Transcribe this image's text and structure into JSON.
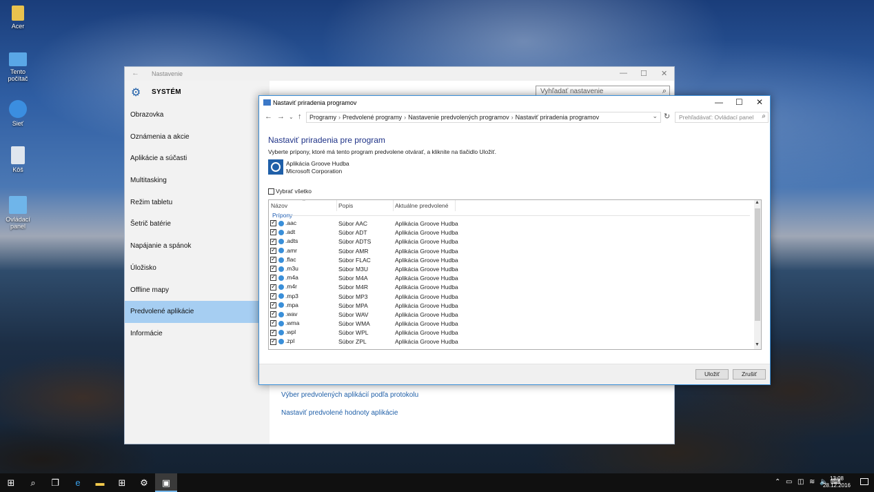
{
  "desktop": {
    "icons": [
      {
        "label": "Acer",
        "icon": "folder-icon"
      },
      {
        "label": "Tento počítač",
        "icon": "computer-icon"
      },
      {
        "label": "Sieť",
        "icon": "network-icon"
      },
      {
        "label": "Kôš",
        "icon": "recycle-bin-icon"
      },
      {
        "label": "Ovládací panel",
        "icon": "control-panel-icon"
      }
    ]
  },
  "settings": {
    "title": "Nastavenie",
    "section": "SYSTÉM",
    "search_placeholder": "Vyhľadať nastavenie",
    "nav": [
      "Obrazovka",
      "Oznámenia a akcie",
      "Aplikácie a súčasti",
      "Multitasking",
      "Režim tabletu",
      "Šetrič batérie",
      "Napájanie a spánok",
      "Úložisko",
      "Offline mapy",
      "Predvolené aplikácie",
      "Informácie"
    ],
    "active_index": 9,
    "links": [
      "Výber predvolených aplikácií podľa protokolu",
      "Nastaviť predvolené hodnoty aplikácie"
    ]
  },
  "dialog": {
    "title": "Nastaviť priradenia programov",
    "breadcrumb": [
      "Programy",
      "Predvolené programy",
      "Nastavenie predvolených programov",
      "Nastaviť priradenia programov"
    ],
    "search_placeholder": "Prehľadávať: Ovládací panel",
    "heading": "Nastaviť priradenia pre program",
    "description": "Vyberte prípony, ktoré má tento program predvolene otvárať, a kliknite na tlačidlo Uložiť.",
    "app_name": "Aplikácia Groove Hudba",
    "app_company": "Microsoft Corporation",
    "select_all": "Vybrať všetko",
    "columns": [
      "Názov",
      "Popis",
      "Aktuálne predvolené"
    ],
    "group": "Prípony",
    "rows": [
      {
        "ext": ".aac",
        "desc": "Súbor AAC",
        "default": "Aplikácia Groove Hudba"
      },
      {
        "ext": ".adt",
        "desc": "Súbor ADT",
        "default": "Aplikácia Groove Hudba"
      },
      {
        "ext": ".adts",
        "desc": "Súbor ADTS",
        "default": "Aplikácia Groove Hudba"
      },
      {
        "ext": ".amr",
        "desc": "Súbor AMR",
        "default": "Aplikácia Groove Hudba"
      },
      {
        "ext": ".flac",
        "desc": "Súbor FLAC",
        "default": "Aplikácia Groove Hudba"
      },
      {
        "ext": ".m3u",
        "desc": "Súbor M3U",
        "default": "Aplikácia Groove Hudba"
      },
      {
        "ext": ".m4a",
        "desc": "Súbor M4A",
        "default": "Aplikácia Groove Hudba"
      },
      {
        "ext": ".m4r",
        "desc": "Súbor M4R",
        "default": "Aplikácia Groove Hudba"
      },
      {
        "ext": ".mp3",
        "desc": "Súbor MP3",
        "default": "Aplikácia Groove Hudba"
      },
      {
        "ext": ".mpa",
        "desc": "Súbor MPA",
        "default": "Aplikácia Groove Hudba"
      },
      {
        "ext": ".wav",
        "desc": "Súbor WAV",
        "default": "Aplikácia Groove Hudba"
      },
      {
        "ext": ".wma",
        "desc": "Súbor WMA",
        "default": "Aplikácia Groove Hudba"
      },
      {
        "ext": ".wpl",
        "desc": "Súbor WPL",
        "default": "Aplikácia Groove Hudba"
      },
      {
        "ext": ".zpl",
        "desc": "Súbor ZPL",
        "default": "Aplikácia Groove Hudba"
      }
    ],
    "save": "Uložiť",
    "cancel": "Zrušiť"
  },
  "taskbar": {
    "time": "13:08",
    "date": "28.12.2016"
  }
}
